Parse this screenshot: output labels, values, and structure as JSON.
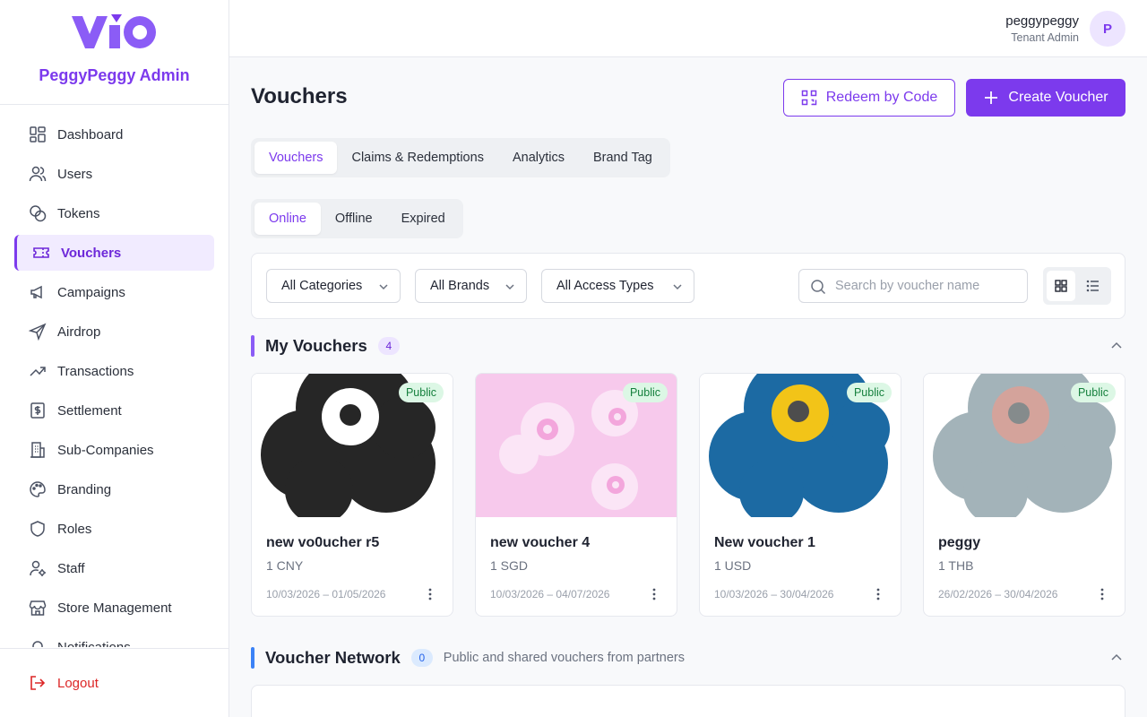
{
  "sidebar": {
    "logo_text": "VIO",
    "org_name": "PeggyPeggy Admin",
    "items": [
      {
        "label": "Dashboard",
        "icon": "dashboard-icon"
      },
      {
        "label": "Users",
        "icon": "users-icon"
      },
      {
        "label": "Tokens",
        "icon": "tokens-icon"
      },
      {
        "label": "Vouchers",
        "icon": "ticket-icon",
        "active": true
      },
      {
        "label": "Campaigns",
        "icon": "megaphone-icon"
      },
      {
        "label": "Airdrop",
        "icon": "send-icon"
      },
      {
        "label": "Transactions",
        "icon": "trending-up-icon"
      },
      {
        "label": "Settlement",
        "icon": "dollar-receipt-icon"
      },
      {
        "label": "Sub-Companies",
        "icon": "building-icon"
      },
      {
        "label": "Branding",
        "icon": "palette-icon"
      },
      {
        "label": "Roles",
        "icon": "shield-icon"
      },
      {
        "label": "Staff",
        "icon": "user-cog-icon"
      },
      {
        "label": "Store Management",
        "icon": "store-icon"
      },
      {
        "label": "Notifications",
        "icon": "bell-icon"
      }
    ],
    "logout_label": "Logout"
  },
  "header": {
    "user_name": "peggypeggy",
    "user_role": "Tenant Admin",
    "avatar_initial": "P"
  },
  "main": {
    "title": "Vouchers",
    "redeem_label": "Redeem by Code",
    "create_label": "Create Voucher",
    "tabs": [
      {
        "label": "Vouchers",
        "active": true
      },
      {
        "label": "Claims & Redemptions"
      },
      {
        "label": "Analytics"
      },
      {
        "label": "Brand Tag"
      }
    ],
    "status_tabs": [
      {
        "label": "Online",
        "active": true
      },
      {
        "label": "Offline"
      },
      {
        "label": "Expired"
      }
    ],
    "filters": {
      "category": "All Categories",
      "brand": "All Brands",
      "access": "All Access Types",
      "search_placeholder": "Search by voucher name"
    },
    "my_vouchers": {
      "title": "My Vouchers",
      "count": "4",
      "cards": [
        {
          "name": "new vo0ucher r5",
          "price": "1 CNY",
          "dates": "10/03/2026 – 01/05/2026",
          "badge": "Public"
        },
        {
          "name": "new voucher 4",
          "price": "1 SGD",
          "dates": "10/03/2026 – 04/07/2026",
          "badge": "Public"
        },
        {
          "name": "New voucher 1",
          "price": "1 USD",
          "dates": "10/03/2026 – 30/04/2026",
          "badge": "Public"
        },
        {
          "name": "peggy",
          "price": "1 THB",
          "dates": "26/02/2026 – 30/04/2026",
          "badge": "Public"
        }
      ]
    },
    "network": {
      "title": "Voucher Network",
      "count": "0",
      "subtitle": "Public and shared vouchers from partners"
    }
  },
  "colors": {
    "accent": "#7c3aed",
    "accent_light": "#f1ebff",
    "danger": "#dc2626",
    "network_accent": "#3b82f6",
    "public_badge_bg": "#dcf7e5",
    "public_badge_text": "#15803d"
  }
}
